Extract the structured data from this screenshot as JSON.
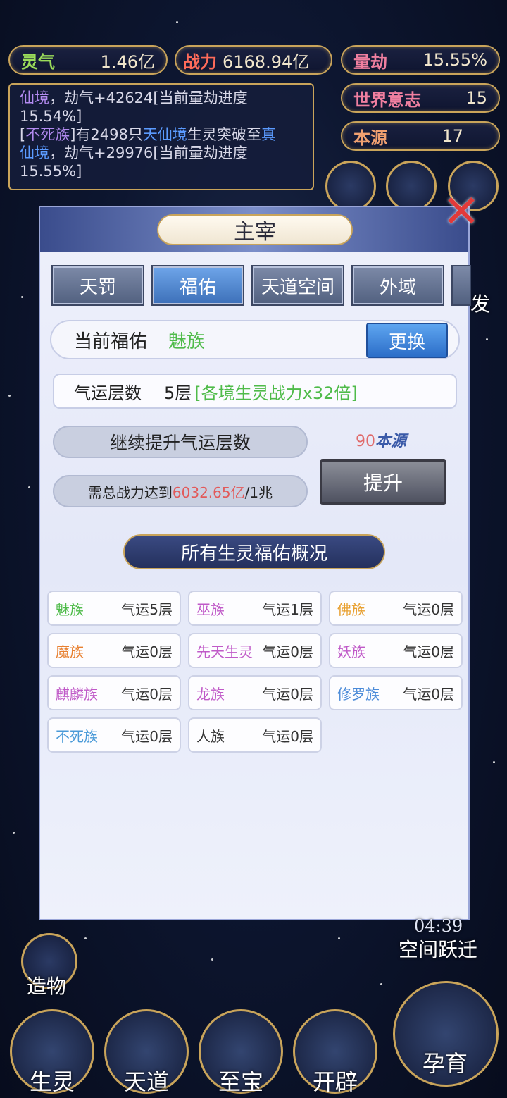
{
  "hud": {
    "lingqi_label": "灵气",
    "lingqi_value": "1.46亿",
    "zhanli_label": "战力",
    "zhanli_value": "6168.94亿",
    "liangjie_label": "量劫",
    "liangjie_value": "15.55%",
    "shijie_label": "世界意志",
    "shijie_value": "15",
    "benyuan_label": "本源",
    "benyuan_value": "17"
  },
  "log": {
    "line1a": "仙境",
    "line1b": "，劫气+42624[当前量劫进度",
    "line2": "15.54%]",
    "line3a": "[",
    "line3b": "不死族",
    "line3c": "]有2498只",
    "line3d": "天仙境",
    "line3e": "生灵突破至",
    "line3f": "真",
    "line4a": "仙境",
    "line4b": "，劫气+29976[当前量劫进度",
    "line5": "15.55%]"
  },
  "modal": {
    "title": "主宰",
    "close_glyph": "✕",
    "tabs": [
      "天罚",
      "福佑",
      "天道空间",
      "外域"
    ],
    "current_label": "当前福佑",
    "current_race": "魅族",
    "swap_label": "更换",
    "luck_label": "气运层数",
    "luck_level": "5层",
    "luck_bonus": "[各境生灵战力x32倍]",
    "continue_label": "继续提升气运层数",
    "need_prefix": "需总战力达到",
    "need_value": "6032.65亿",
    "need_suffix": "/1兆",
    "cost_amount": "90",
    "cost_currency": "本源",
    "raise_label": "提升",
    "section_title": "所有生灵福佑概况"
  },
  "races": [
    {
      "name": "魅族",
      "luck": "气运5层",
      "color": "#4fbb4a"
    },
    {
      "name": "巫族",
      "luck": "气运1层",
      "color": "#c05ac8"
    },
    {
      "name": "佛族",
      "luck": "气运0层",
      "color": "#e8a030"
    },
    {
      "name": "魔族",
      "luck": "气运0层",
      "color": "#e88030"
    },
    {
      "name": "先天生灵",
      "luck": "气运0层",
      "color": "#c05ac8"
    },
    {
      "name": "妖族",
      "luck": "气运0层",
      "color": "#c05ac8"
    },
    {
      "name": "麒麟族",
      "luck": "气运0层",
      "color": "#c05ac8"
    },
    {
      "name": "龙族",
      "luck": "气运0层",
      "color": "#c05ac8"
    },
    {
      "name": "修罗族",
      "luck": "气运0层",
      "color": "#4a8ad8"
    },
    {
      "name": "不死族",
      "luck": "气运0层",
      "color": "#4a9ad8"
    },
    {
      "name": "人族",
      "luck": "气运0层",
      "color": "#333333"
    }
  ],
  "side": {
    "timer": "04:39",
    "space_jump": "空间跃迁",
    "create": "造物",
    "right_partial": "发"
  },
  "bottom": [
    "生灵",
    "天道",
    "至宝",
    "开辟",
    "孕育"
  ]
}
